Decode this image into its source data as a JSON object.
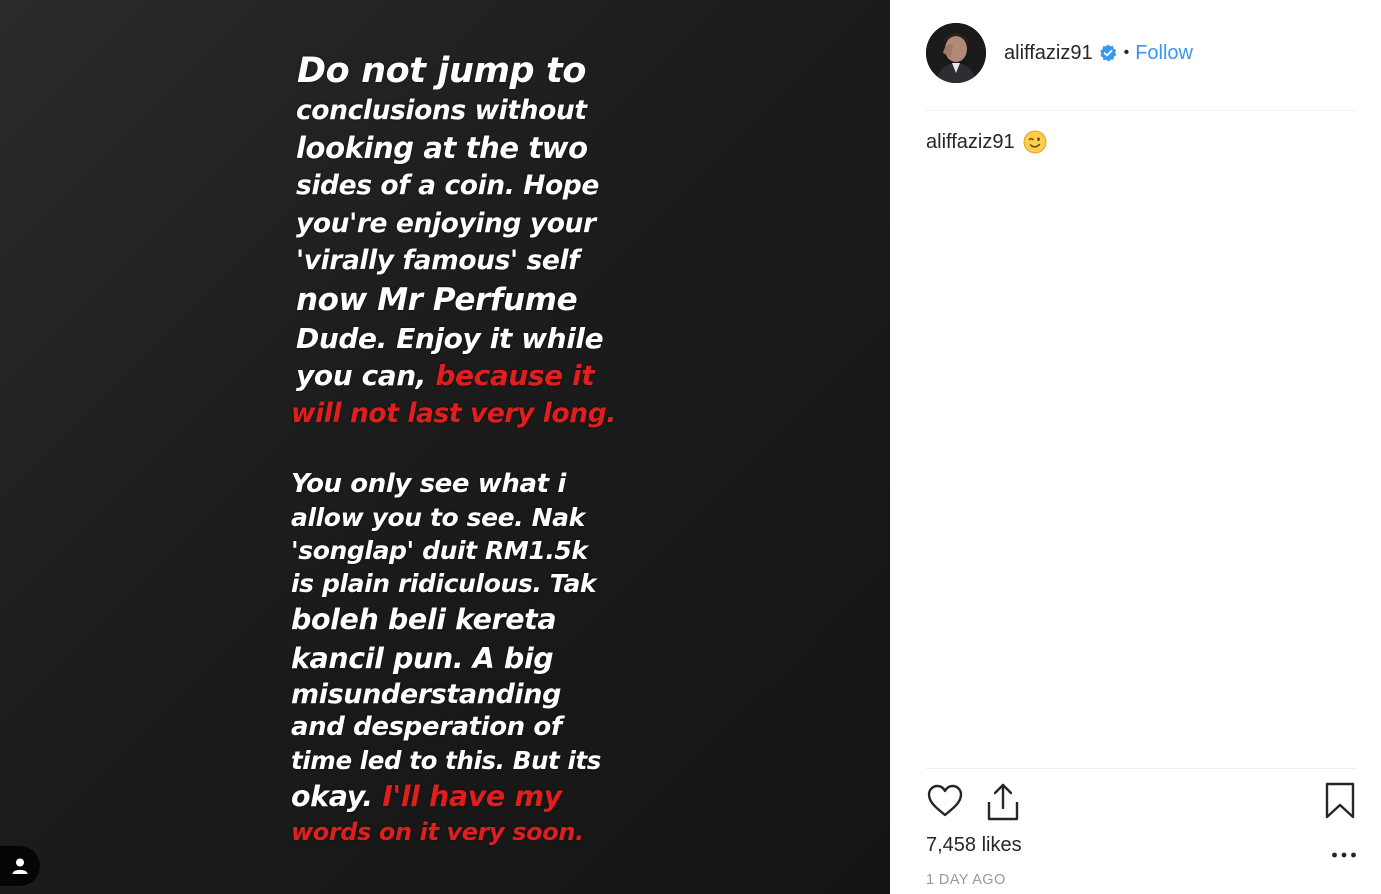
{
  "story": {
    "lines_p1": [
      "Do not jump to",
      "conclusions without",
      "looking at the two",
      "sides of a coin. Hope",
      "you're enjoying your",
      "'virally famous' self",
      "now Mr Perfume",
      "Dude. Enjoy it while"
    ],
    "line9_white": "you can, ",
    "line9_red": "because it",
    "line10_red": "will not last very long.",
    "lines_p2": [
      "You only see what i",
      "allow you to see. Nak",
      "'songlap' duit RM1.5k",
      "is plain ridiculous. Tak",
      "boleh beli kereta",
      "kancil pun. A big",
      "misunderstanding",
      "and desperation of",
      "time led to this. But its"
    ],
    "last_white": "okay. ",
    "last_red": "I'll have my",
    "final_red": "words on it very soon."
  },
  "post": {
    "username": "aliffaziz91",
    "separator": "•",
    "follow_label": "Follow",
    "caption_user": "aliffaziz91",
    "likes": "7,458 likes",
    "time_ago": "1 DAY AGO"
  },
  "colors": {
    "accent": "#3897f0",
    "story_red": "#e01e1e",
    "text": "#262626",
    "muted": "#999999"
  },
  "icons": [
    "user-tag-icon",
    "verified-badge-icon",
    "wink-emoji-icon",
    "heart-icon",
    "share-icon",
    "bookmark-icon",
    "more-options-icon"
  ]
}
